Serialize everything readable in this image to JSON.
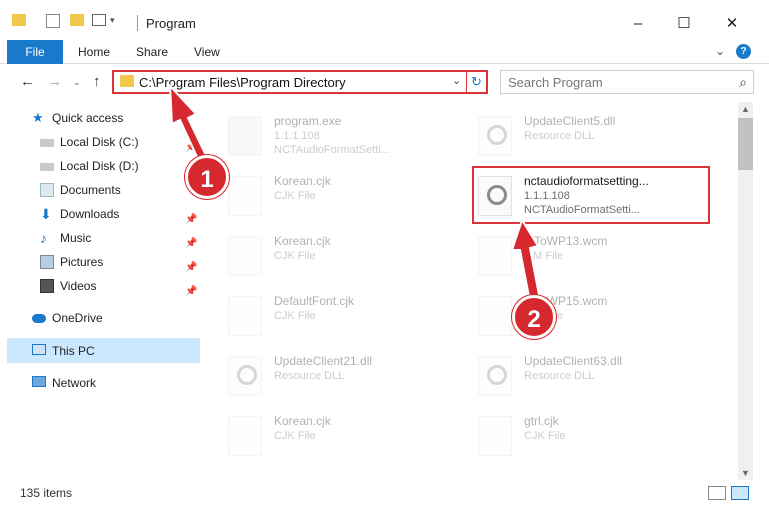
{
  "window": {
    "title": "Program",
    "minimize": "–",
    "maximize": "☐",
    "close": "✕"
  },
  "ribbon": {
    "tabs": [
      "File",
      "Home",
      "Share",
      "View"
    ],
    "help": "?"
  },
  "address": {
    "path": "C:\\Program Files\\Program Directory",
    "search_placeholder": "Search Program"
  },
  "nav": {
    "quick_access": "Quick access",
    "items": [
      {
        "label": "Local Disk (C:)",
        "icon": "drive-icon"
      },
      {
        "label": "Local Disk (D:)",
        "icon": "drive-icon"
      },
      {
        "label": "Documents",
        "icon": "documents-icon"
      },
      {
        "label": "Downloads",
        "icon": "downloads-icon"
      },
      {
        "label": "Music",
        "icon": "music-icon"
      },
      {
        "label": "Pictures",
        "icon": "pictures-icon"
      },
      {
        "label": "Videos",
        "icon": "videos-icon"
      }
    ],
    "onedrive": "OneDrive",
    "thispc": "This PC",
    "network": "Network"
  },
  "files": {
    "left": [
      {
        "name": "program.exe",
        "sub": "1.1.1.108",
        "sub2": "NCTAudioFormatSetti..."
      },
      {
        "name": "Korean.cjk",
        "sub": "CJK File"
      },
      {
        "name": "Korean.cjk",
        "sub": "CJK File"
      },
      {
        "name": "DefaultFont.cjk",
        "sub": "CJK File"
      },
      {
        "name": "UpdateClient21.dll",
        "sub": "Resource DLL"
      },
      {
        "name": "Korean.cjk",
        "sub": "CJK File"
      }
    ],
    "right": [
      {
        "name": "UpdateClient5.dll",
        "sub": "Resource DLL"
      },
      {
        "name": "nctaudioformatsetting...",
        "sub": "1.1.1.108",
        "sub2": "NCTAudioFormatSetti..."
      },
      {
        "name": "...ToWP13.wcm",
        "sub": "...M File"
      },
      {
        "name": "...ToWP15.wcm",
        "sub": "...M File"
      },
      {
        "name": "UpdateClient63.dll",
        "sub": "Resource DLL"
      },
      {
        "name": "gtrl.cjk",
        "sub": "CJK File"
      }
    ]
  },
  "status": {
    "count": "135 items"
  },
  "annotations": {
    "step1": "1",
    "step2": "2"
  },
  "colors": {
    "accent": "#1979ca",
    "highlight": "#d9343a",
    "selection": "#cce8ff"
  }
}
